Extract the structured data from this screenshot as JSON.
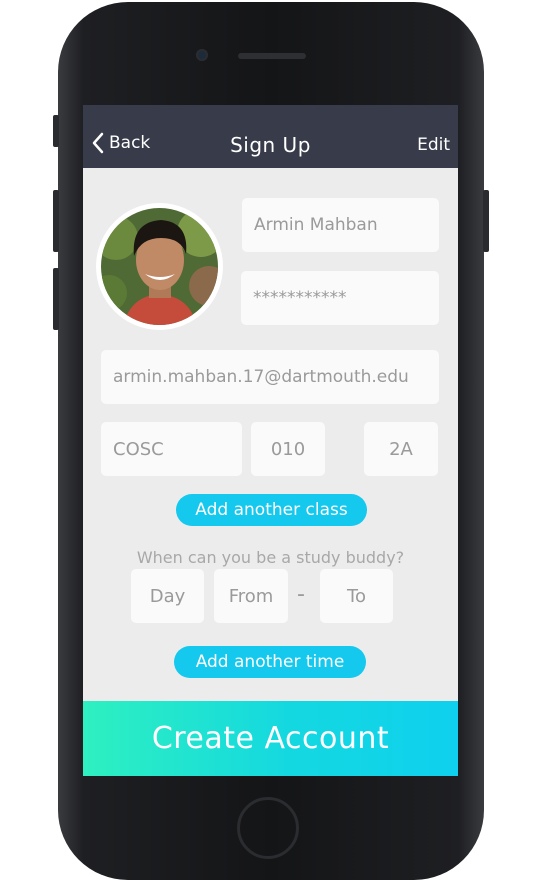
{
  "navbar": {
    "back_label": "Back",
    "title": "Sign Up",
    "edit_label": "Edit"
  },
  "form": {
    "name_value": "Armin Mahban",
    "password_value": "***********",
    "email_value": "armin.mahban.17@dartmouth.edu",
    "class_department": "COSC",
    "class_number": "010",
    "class_section": "2A",
    "add_class_label": "Add another class",
    "availability_prompt": "When can you be a study buddy?",
    "day_placeholder": "Day",
    "from_placeholder": "From",
    "range_separator": "-",
    "to_placeholder": "To",
    "add_time_label": "Add another time",
    "create_label": "Create Account"
  },
  "colors": {
    "navbar": "#383c4a",
    "accent": "#14c8ee",
    "create_start": "#2ef0c0",
    "create_end": "#0fd0ee"
  }
}
